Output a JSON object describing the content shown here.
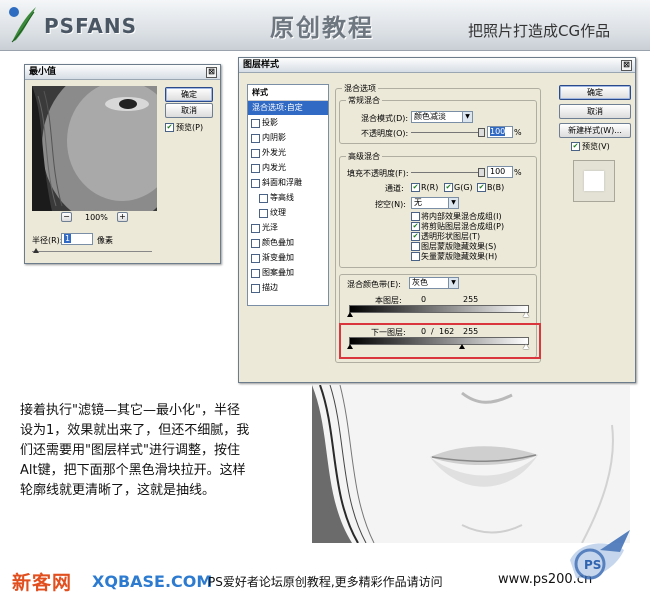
{
  "header": {
    "logo": "PSFANS",
    "title": "原创教程",
    "subtitle": "把照片打造成CG作品"
  },
  "min_dialog": {
    "title": "最小值",
    "ok": "确定",
    "cancel": "取消",
    "preview_label": "预览(P)",
    "zoom_out": "−",
    "zoom_level": "100%",
    "zoom_in": "+",
    "radius_label": "半径(R):",
    "radius_value": "1",
    "radius_unit": "像素"
  },
  "layer_style": {
    "title": "图层样式",
    "styles_header": "样式",
    "styles": [
      {
        "label": "混合选项:自定",
        "checked": false,
        "selected": true
      },
      {
        "label": "投影",
        "checked": false
      },
      {
        "label": "内阴影",
        "checked": false
      },
      {
        "label": "外发光",
        "checked": false
      },
      {
        "label": "内发光",
        "checked": false
      },
      {
        "label": "斜面和浮雕",
        "checked": false
      },
      {
        "label": "等高线",
        "checked": false
      },
      {
        "label": "纹理",
        "checked": false
      },
      {
        "label": "光泽",
        "checked": false
      },
      {
        "label": "颜色叠加",
        "checked": false
      },
      {
        "label": "渐变叠加",
        "checked": false
      },
      {
        "label": "图案叠加",
        "checked": false
      },
      {
        "label": "描边",
        "checked": false
      }
    ],
    "blend_options": "混合选项",
    "general_blending": "常规混合",
    "blend_mode_label": "混合模式(D):",
    "blend_mode_value": "颜色减淡",
    "opacity_label": "不透明度(O):",
    "opacity_value": "100",
    "percent": "%",
    "advanced_blending": "高级混合",
    "fill_opacity_label": "填充不透明度(F):",
    "fill_opacity_value": "100",
    "channels_label": "通道:",
    "channel_r": "R(R)",
    "channel_g": "G(G)",
    "channel_b": "B(B)",
    "knockout_label": "挖空(N):",
    "knockout_value": "无",
    "options": [
      {
        "label": "将内部效果混合成组(I)",
        "checked": false
      },
      {
        "label": "将剪贴图层混合成组(P)",
        "checked": true
      },
      {
        "label": "透明形状图层(T)",
        "checked": true
      },
      {
        "label": "图层蒙版隐藏效果(S)",
        "checked": false
      },
      {
        "label": "矢量蒙版隐藏效果(H)",
        "checked": false
      }
    ],
    "blend_if_label": "混合颜色带(E):",
    "blend_if_value": "灰色",
    "this_layer_label": "本图层:",
    "this_layer_min": "0",
    "this_layer_max": "255",
    "underlying_label": "下一图层:",
    "underlying_min": "0",
    "underlying_slash": "/",
    "underlying_mid": "162",
    "underlying_max": "255",
    "ok": "确定",
    "cancel": "取消",
    "new_style": "新建样式(W)...",
    "preview_label": "预览(V)"
  },
  "instructions": "接着执行\"滤镜—其它—最小化\"，半径设为1，效果就出来了，但还不细腻，我们还需要用\"图层样式\"进行调整，按住Alt键，把下面那个黑色滑块拉开。这样轮廓线就更清晰了，这就是抽线。",
  "footer": {
    "left": "新客网",
    "left_url": "XQBASE.COM",
    "middle": "PS爱好者论坛原创教程,更多精彩作品请访问",
    "right": "www.ps200.cn",
    "seal": "PS"
  },
  "colors": {
    "accent_red": "#d9363e",
    "selection_blue": "#316ac5",
    "footer_orange": "#e24f1e"
  }
}
